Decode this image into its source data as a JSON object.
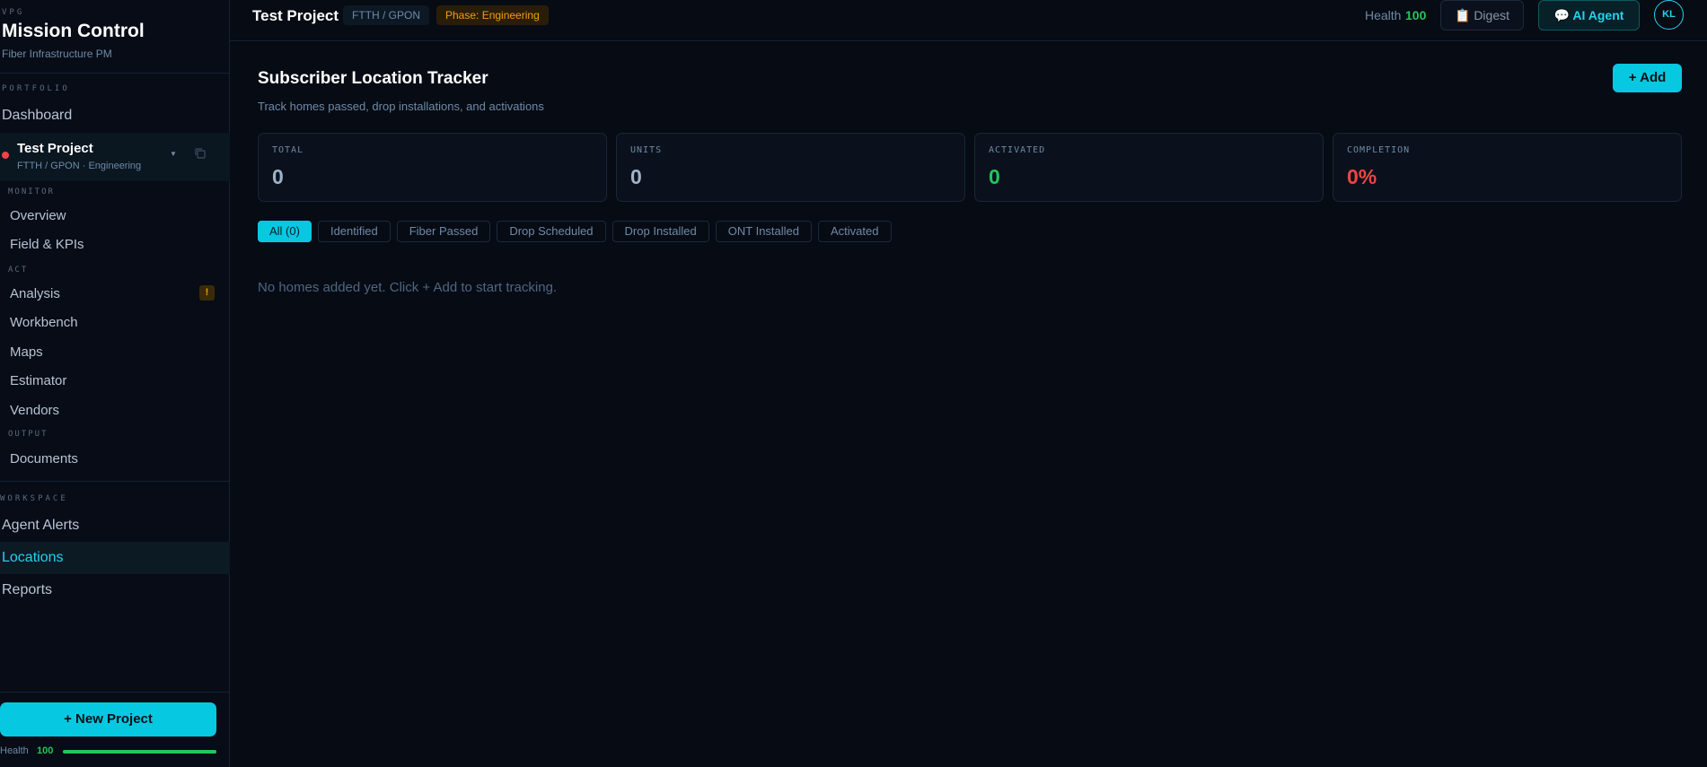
{
  "sidebar": {
    "brand_kicker": "VPG",
    "brand_title": "Mission Control",
    "brand_subtitle": "Fiber Infrastructure PM",
    "portfolio_label": "PORTFOLIO",
    "dashboard_label": "Dashboard",
    "project": {
      "name": "Test Project",
      "meta": "FTTH / GPON · Engineering",
      "status_color": "#ef4444",
      "caret_icon": "chevron-down-icon",
      "copy_icon": "copy-icon"
    },
    "monitor_label": "MONITOR",
    "monitor_items": [
      "Overview",
      "Field & KPIs"
    ],
    "act_label": "ACT",
    "act_items": [
      "Analysis",
      "Workbench",
      "Maps",
      "Estimator",
      "Vendors"
    ],
    "analysis_badge": "!",
    "output_label": "OUTPUT",
    "output_items": [
      "Documents"
    ],
    "workspace_label": "WORKSPACE",
    "workspace_items": [
      "Agent Alerts",
      "Locations",
      "Reports"
    ],
    "active_item": "Locations",
    "new_project_label": "+ New Project",
    "health_label": "Health",
    "health_value": "100",
    "health_fraction": 1.0
  },
  "topbar": {
    "title": "Test Project",
    "tech_chip": "FTTH / GPON",
    "phase_chip": "Phase: Engineering",
    "health_label": "Health",
    "health_value": "100",
    "digest_label": "Digest",
    "digest_icon": "clipboard-icon",
    "agent_label": "AI Agent",
    "agent_icon": "chat-bubble-icon",
    "avatar_initials": "KL"
  },
  "main": {
    "title": "Subscriber Location Tracker",
    "subtitle": "Track homes passed, drop installations, and activations",
    "add_label": "+ Add",
    "stats": [
      {
        "label": "TOTAL",
        "value": "0",
        "color": "#9fb3c8"
      },
      {
        "label": "UNITS",
        "value": "0",
        "color": "#9fb3c8"
      },
      {
        "label": "ACTIVATED",
        "value": "0",
        "color": "#22c55e"
      },
      {
        "label": "COMPLETION",
        "value": "0%",
        "color": "#ef4444"
      }
    ],
    "filters": [
      "All (0)",
      "Identified",
      "Fiber Passed",
      "Drop Scheduled",
      "Drop Installed",
      "ONT Installed",
      "Activated"
    ],
    "active_filter": "All (0)",
    "empty_message": "No homes added yet. Click + Add to start tracking."
  },
  "colors": {
    "accent": "#06c8e0",
    "background": "#060b14",
    "success": "#22c55e",
    "danger": "#ef4444",
    "warning": "#f59e0b"
  }
}
